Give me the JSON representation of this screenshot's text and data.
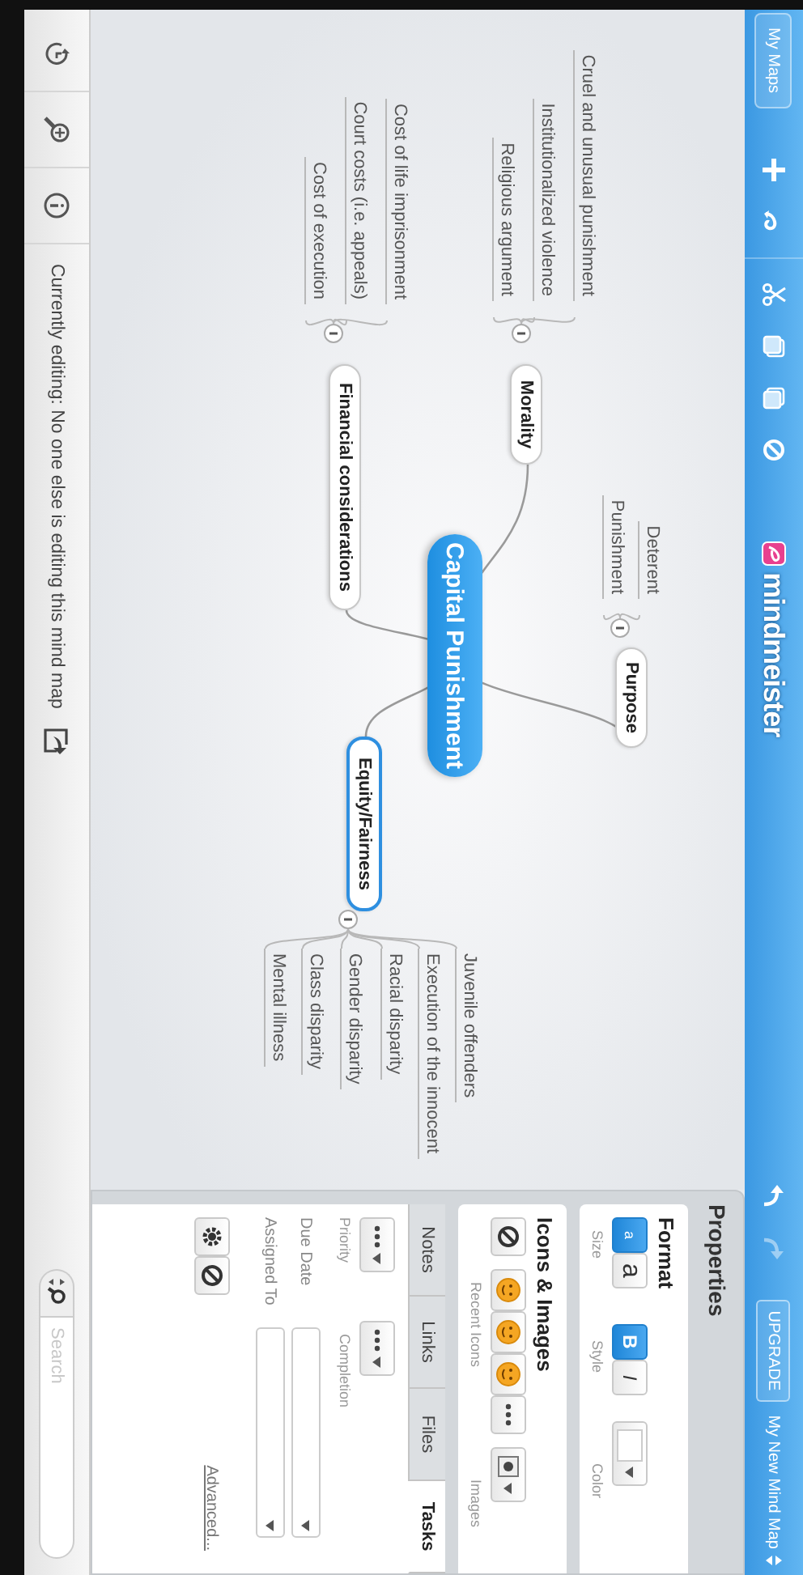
{
  "toolbar": {
    "my_maps": "My Maps",
    "logo": "mindmeister",
    "upgrade": "UPGRADE",
    "map_title": "My New Mind Map"
  },
  "map": {
    "central": {
      "label": "Capital Punishment"
    },
    "branches": [
      {
        "label": "Purpose",
        "selected": false,
        "children": [
          {
            "label": "Deterent"
          },
          {
            "label": "Punishment"
          }
        ]
      },
      {
        "label": "Morality",
        "selected": false,
        "children": [
          {
            "label": "Cruel and unusual punishment"
          },
          {
            "label": "Institutionalized violence"
          },
          {
            "label": "Religious argument"
          }
        ]
      },
      {
        "label": "Financial considerations",
        "selected": false,
        "children": [
          {
            "label": "Cost of life imprisonment"
          },
          {
            "label": "Court costs (i.e. appeals)"
          },
          {
            "label": "Cost of execution"
          }
        ]
      },
      {
        "label": "Equity/Fairness",
        "selected": true,
        "children": [
          {
            "label": "Juvenile offenders"
          },
          {
            "label": "Execution of the innocent"
          },
          {
            "label": "Racial disparity"
          },
          {
            "label": "Gender disparity"
          },
          {
            "label": "Class disparity"
          },
          {
            "label": "Mental illness"
          }
        ]
      }
    ]
  },
  "properties": {
    "title": "Properties",
    "format": {
      "title": "Format",
      "size_buttons": [
        {
          "label": "a",
          "selected": true
        },
        {
          "label": "a",
          "selected": false
        }
      ],
      "style_buttons": [
        {
          "label": "B",
          "selected": true
        },
        {
          "label": "I",
          "selected": false
        }
      ],
      "labels": [
        "Size",
        "Style",
        "Color"
      ]
    },
    "icons": {
      "title": "Icons & Images",
      "labels": [
        "Recent Icons",
        "Images"
      ]
    },
    "tabs": [
      {
        "label": "Notes",
        "selected": false
      },
      {
        "label": "Links",
        "selected": false
      },
      {
        "label": "Files",
        "selected": false
      },
      {
        "label": "Tasks",
        "selected": true
      }
    ],
    "tasks": {
      "priority_label": "Priority",
      "completion_label": "Completion",
      "due_date_label": "Due Date",
      "assigned_to_label": "Assigned To",
      "advanced": "Advanced..."
    }
  },
  "status_bar": {
    "text": "Currently editing: No one else is editing this mind map"
  },
  "search": {
    "placeholder": "Search"
  }
}
